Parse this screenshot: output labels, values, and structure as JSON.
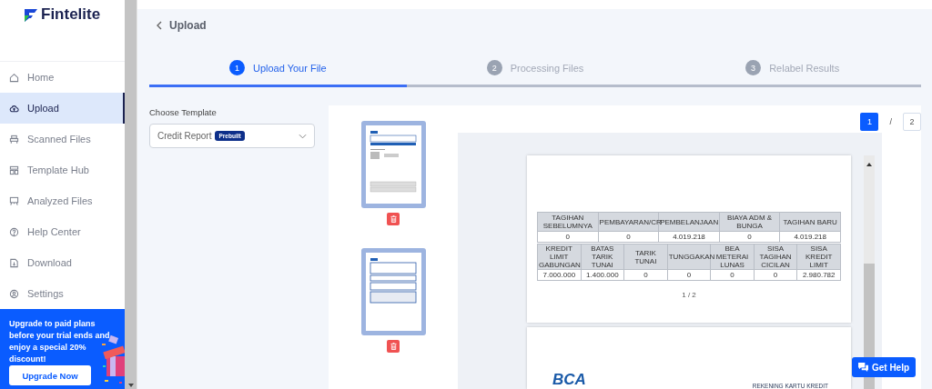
{
  "brand": {
    "name": "Fintelite"
  },
  "nav": [
    {
      "label": "Home",
      "selected": false
    },
    {
      "label": "Upload",
      "selected": true
    },
    {
      "label": "Scanned Files",
      "selected": false
    },
    {
      "label": "Template Hub",
      "selected": false
    },
    {
      "label": "Analyzed Files",
      "selected": false
    },
    {
      "label": "Help Center",
      "selected": false
    },
    {
      "label": "Download",
      "selected": false
    },
    {
      "label": "Settings",
      "selected": false
    }
  ],
  "promo": {
    "text": "Upgrade to paid plans before your trial ends and enjoy a special 20% discount!",
    "button": "Upgrade Now"
  },
  "header": {
    "title": "Upload"
  },
  "steps": [
    {
      "number": "1",
      "label": "Upload Your File",
      "active": true
    },
    {
      "number": "2",
      "label": "Processing Files",
      "active": false
    },
    {
      "number": "3",
      "label": "Relabel Results",
      "active": false
    }
  ],
  "template": {
    "label": "Choose Template",
    "value": "Credit Report",
    "badge": "Prebuilt"
  },
  "thumbnails": [
    {
      "kind": "table-page"
    },
    {
      "kind": "text-page"
    }
  ],
  "pager": {
    "current": "1",
    "separator": "/",
    "total": "2"
  },
  "document": {
    "tables": [
      {
        "columns": [
          "TAGIHAN SEBELUMNYA",
          "PEMBAYARAN/CR",
          "PEMBELANJAAN",
          "BIAYA ADM & BUNGA",
          "TAGIHAN BARU"
        ],
        "values": [
          "0",
          "0",
          "4.019.218",
          "0",
          "4.019.218"
        ]
      },
      {
        "columns": [
          "KREDIT LIMIT GABUNGAN",
          "BATAS TARIK TUNAI",
          "TARIK TUNAI",
          "TUNGGAKAN",
          "BEA METERAI LUNAS",
          "SISA TAGIHAN CICILAN",
          "SISA KREDIT LIMIT"
        ],
        "values": [
          "7.000.000",
          "1.400.000",
          "0",
          "0",
          "0",
          "0",
          "2.980.782"
        ]
      }
    ],
    "page_number": "1 / 2",
    "logo": "BCA",
    "heading": "REKENING KARTU KREDIT"
  },
  "help_button": "Get Help"
}
